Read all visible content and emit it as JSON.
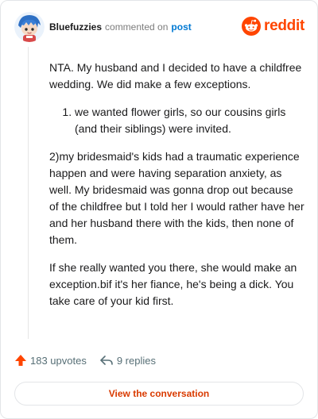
{
  "comment": {
    "username": "Bluefuzzies",
    "action_text": "commented on",
    "post_link": "post",
    "paragraphs": [
      "NTA. My husband and I decided to have a childfree wedding. We did make a few exceptions.",
      "2)my bridesmaid's kids had a traumatic experience happen and were having separation anxiety, as well. My bridesmaid was gonna drop out because of the childfree but I told her I would rather have her and her husband there with the kids, then none of them.",
      "If she really wanted you there, she would make an exception.bif it's her fiance, he's being a dick. You take care of your kid first."
    ],
    "list_items": [
      "we wanted flower girls, so our cousins girls (and their siblings) were invited."
    ]
  },
  "brand": {
    "wordmark": "reddit",
    "icon": "reddit-snoo-icon",
    "color": "#ff4500"
  },
  "footer": {
    "upvotes": "183 upvotes",
    "replies": "9 replies",
    "upvote_icon": "upvote-arrow-icon",
    "reply_icon": "reply-arrow-icon",
    "upvote_color": "#ff4500"
  },
  "action": {
    "view_label": "View the conversation",
    "color": "#d93a00"
  },
  "avatar": {
    "icon": "avatar-icon"
  }
}
